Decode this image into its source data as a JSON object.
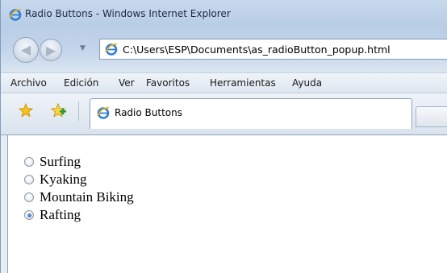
{
  "window": {
    "title": "Radio Buttons - Windows Internet Explorer"
  },
  "address_bar": {
    "url": "C:\\Users\\ESP\\Documents\\as_radioButton_popup.html"
  },
  "menu": {
    "items": [
      "Archivo",
      "Edición",
      "Ver",
      "Favoritos",
      "Herramientas",
      "Ayuda"
    ]
  },
  "tab": {
    "label": "Radio Buttons"
  },
  "radio_group": {
    "options": [
      {
        "label": "Surfing",
        "checked": false
      },
      {
        "label": "Kyaking",
        "checked": false
      },
      {
        "label": "Mountain Biking",
        "checked": false
      },
      {
        "label": "Rafting",
        "checked": true
      }
    ]
  },
  "icons": {
    "browser": "ie-logo-icon",
    "back": "back-arrow-icon",
    "forward": "forward-arrow-icon",
    "favorites": "favorites-star-icon",
    "add_favorite": "add-favorite-icon"
  },
  "colors": {
    "accent": "#1f5fa8",
    "chrome": "#c8d9ec",
    "content_bg": "#ffffff"
  }
}
